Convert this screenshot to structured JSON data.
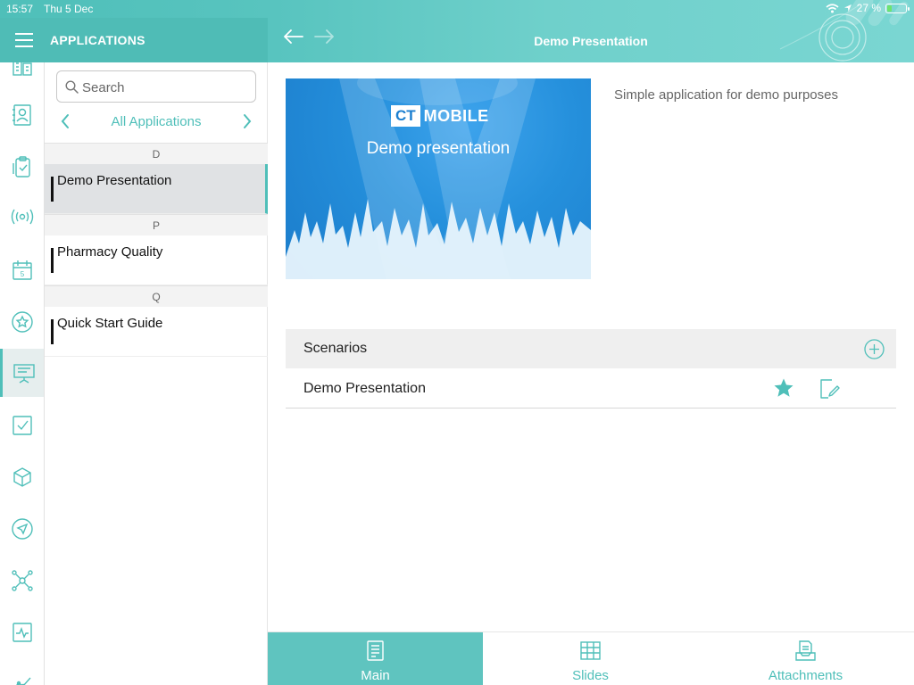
{
  "status": {
    "time": "15:57",
    "date": "Thu 5 Dec",
    "battery": "27 %",
    "battery_level": 0.27
  },
  "sidebar_header": {
    "title": "APPLICATIONS"
  },
  "main_header": {
    "title": "Demo Presentation"
  },
  "search": {
    "placeholder": "Search"
  },
  "filter": {
    "label": "All Applications"
  },
  "rail": {
    "icons": [
      "buildings-icon",
      "contacts-icon",
      "clipboard-icon",
      "broadcast-icon",
      "calendar-icon",
      "star-circle-icon",
      "presentation-icon",
      "checkbox-icon",
      "cube-icon",
      "navigation-icon",
      "network-icon",
      "activity-icon",
      "chart-line-icon"
    ],
    "active": "presentation-icon"
  },
  "app_list": {
    "sections": [
      {
        "letter": "D",
        "items": [
          {
            "name": "Demo Presentation",
            "selected": true
          }
        ]
      },
      {
        "letter": "P",
        "items": [
          {
            "name": "Pharmacy Quality",
            "selected": false
          }
        ]
      },
      {
        "letter": "Q",
        "items": [
          {
            "name": "Quick Start Guide",
            "selected": false
          }
        ]
      }
    ]
  },
  "detail": {
    "thumbnail": {
      "logo_ct": "CT",
      "logo_mobile": "MOBILE",
      "caption": "Demo presentation"
    },
    "description": "Simple application for demo purposes",
    "scenarios_label": "Scenarios",
    "scenarios": [
      {
        "name": "Demo Presentation"
      }
    ]
  },
  "tabs": [
    {
      "label": "Main",
      "icon": "document-list-icon",
      "active": true
    },
    {
      "label": "Slides",
      "icon": "slides-grid-icon",
      "active": false
    },
    {
      "label": "Attachments",
      "icon": "inbox-tray-icon",
      "active": false
    }
  ],
  "colors": {
    "accent": "#4fbfb9",
    "header": "#58c4bf",
    "star": "#4fbfb9"
  }
}
